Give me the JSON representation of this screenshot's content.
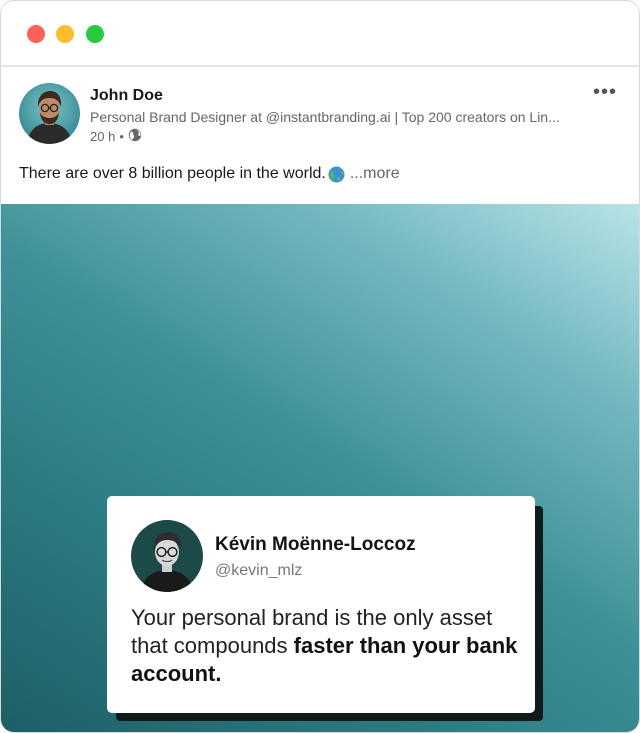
{
  "window": {
    "controls": [
      "close",
      "minimize",
      "maximize"
    ],
    "colors": {
      "close": "#ff6058",
      "minimize": "#ffbd2e",
      "maximize": "#28c840"
    }
  },
  "post": {
    "author": {
      "name": "John Doe",
      "headline": "Personal Brand Designer at @instantbranding.ai | Top 200 creators on Lin...",
      "time": "20 h",
      "separator": "•",
      "visibility_icon": "globe-icon"
    },
    "menu_icon": "more-horizontal-icon",
    "menu_label": "•••",
    "text": "There are over 8 billion people in the world.",
    "text_emoji_icon": "earth-globe-icon",
    "more_label": "...more"
  },
  "image": {
    "gradient_colors": [
      "#b8e4e8",
      "#3e9198",
      "#1e5f66"
    ],
    "card": {
      "name": "Kévin Moënne-Loccoz",
      "handle": "@kevin_mlz",
      "quote_regular": "Your personal brand is the only asset that compounds ",
      "quote_bold": "faster than your bank account."
    }
  }
}
